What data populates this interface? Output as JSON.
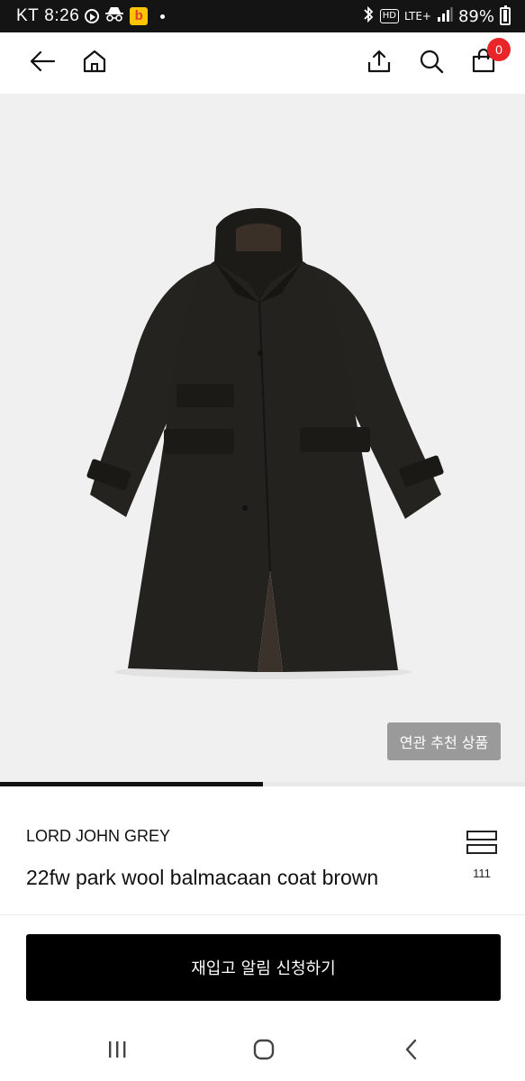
{
  "status_bar": {
    "carrier": "KT",
    "time": "8:26",
    "network_hd": "HD",
    "network_type": "LTE+",
    "battery": "89%"
  },
  "header": {
    "icons": [
      "back-arrow-icon",
      "home-icon",
      "share-icon",
      "search-icon",
      "cart-icon"
    ],
    "cart_count": "0"
  },
  "product": {
    "image_alt": "Dark brown wool balmacaan coat",
    "related_button": "연관 추천 상품",
    "image_progress": 0.5,
    "brand": "LORD JOHN GREY",
    "title": "22fw park wool balmacaan coat brown",
    "compare_count": "111"
  },
  "cta": {
    "restock_button": "재입고 알림 신청하기"
  },
  "navbar": {
    "icons": [
      "recent-apps-icon",
      "home-circle-icon",
      "back-chevron-icon"
    ]
  },
  "colors": {
    "badge": "#e8262a",
    "button_bg": "#000000",
    "related_bg": "#9a9a9a",
    "image_bg": "#f0f0f0"
  }
}
